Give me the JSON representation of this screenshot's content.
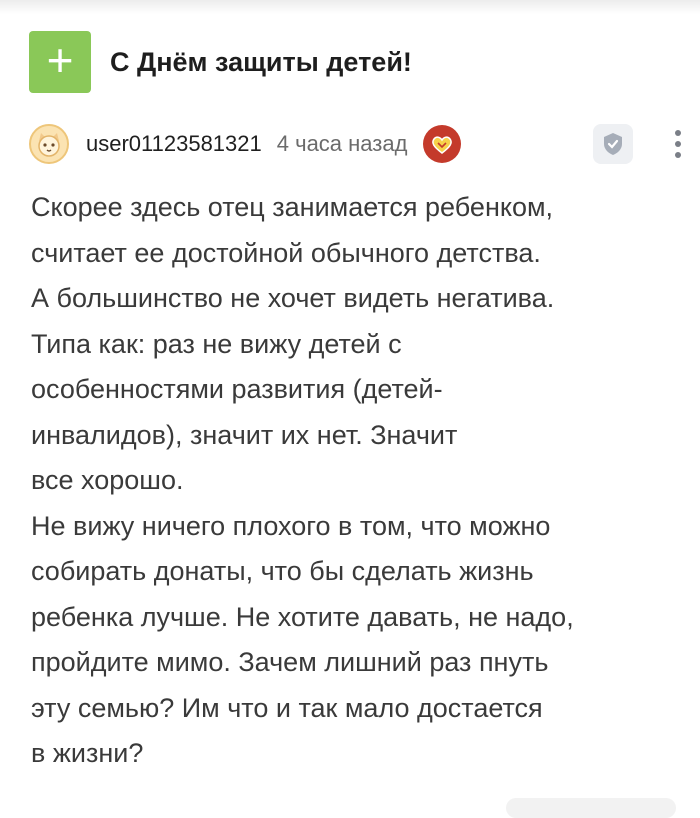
{
  "post": {
    "add_label": "+",
    "title": "С Днём защиты детей!"
  },
  "comment": {
    "username": "user01123581321",
    "time": "4 часа назад",
    "avatar_icon": "cat-face-icon",
    "badge_icon": "heart-badge-icon",
    "lines": [
      "Скорее здесь отец занимается ребенком,",
      "считает ее достойной обычного детства.",
      "А большинство не хочет видеть негатива.",
      "Типа как: раз не вижу детей с",
      "особенностями развития (детей-",
      "инвалидов), значит их нет. Значит",
      "все хорошо.",
      "Не вижу ничего плохого в том, что можно",
      "собирать донаты, что бы сделать жизнь",
      "ребенка лучше. Не хотите давать, не надо,",
      "пройдите мимо. Зачем лишний раз пнуть",
      "эту семью? Им что и так мало достается",
      "в жизни?"
    ]
  },
  "colors": {
    "add_button": "#8ac858",
    "badge": "#c43a2b",
    "text": "#3a3a3a"
  }
}
